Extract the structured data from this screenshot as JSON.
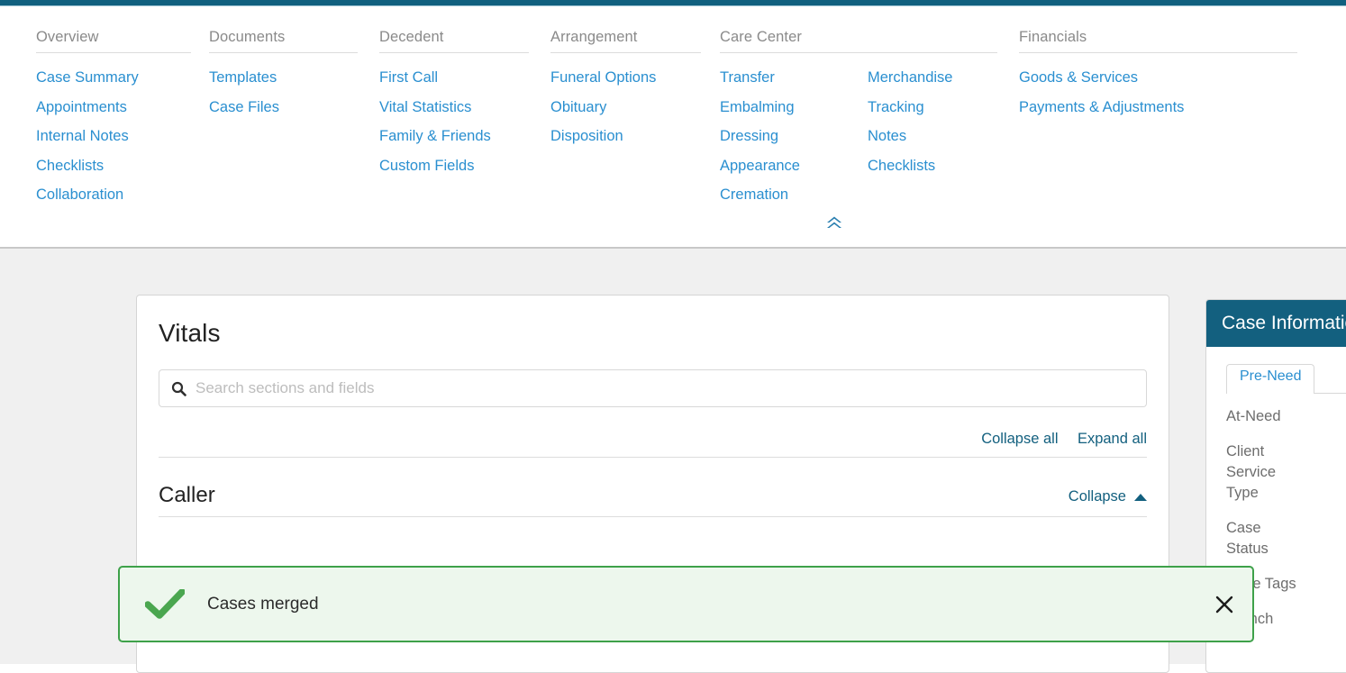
{
  "theme": {
    "accent_dark": "#13607f",
    "link_blue": "#2a8fd0",
    "success_green": "#3ea14a",
    "success_bg": "#edf7ed"
  },
  "mega_nav": {
    "collapse_icon": "double-chevron-up-icon",
    "columns": [
      {
        "title": "Overview",
        "groups": [
          [
            "Case Summary",
            "Appointments",
            "Internal Notes",
            "Checklists",
            "Collaboration"
          ]
        ]
      },
      {
        "title": "Documents",
        "groups": [
          [
            "Templates",
            "Case Files"
          ]
        ]
      },
      {
        "title": "Decedent",
        "groups": [
          [
            "First Call",
            "Vital Statistics",
            "Family & Friends",
            "Custom Fields"
          ]
        ]
      },
      {
        "title": "Arrangement",
        "groups": [
          [
            "Funeral Options",
            "Obituary",
            "Disposition"
          ]
        ]
      },
      {
        "title": "Care Center",
        "groups": [
          [
            "Transfer",
            "Embalming",
            "Dressing",
            "Appearance",
            "Cremation"
          ],
          [
            "Merchandise",
            "Tracking",
            "Notes",
            "Checklists"
          ]
        ]
      },
      {
        "title": "Financials",
        "groups": [
          [
            "Goods & Services",
            "Payments & Adjustments"
          ]
        ]
      }
    ]
  },
  "main_card": {
    "title": "Vitals",
    "search": {
      "placeholder": "Search sections and fields",
      "value": "",
      "icon": "search-icon"
    },
    "collapse_all_label": "Collapse all",
    "expand_all_label": "Expand all",
    "section": {
      "title": "Caller",
      "collapse_label": "Collapse",
      "collapse_icon": "caret-up-icon"
    }
  },
  "side_panel": {
    "header": "Case Information",
    "tabs": [
      {
        "label": "Pre-Need",
        "active": true
      }
    ],
    "fields": [
      "At-Need",
      "Client Service Type",
      "Case Status",
      "Case Tags",
      "Branch"
    ]
  },
  "toast": {
    "message": "Cases merged",
    "icon": "check-icon",
    "close_icon": "close-icon"
  }
}
